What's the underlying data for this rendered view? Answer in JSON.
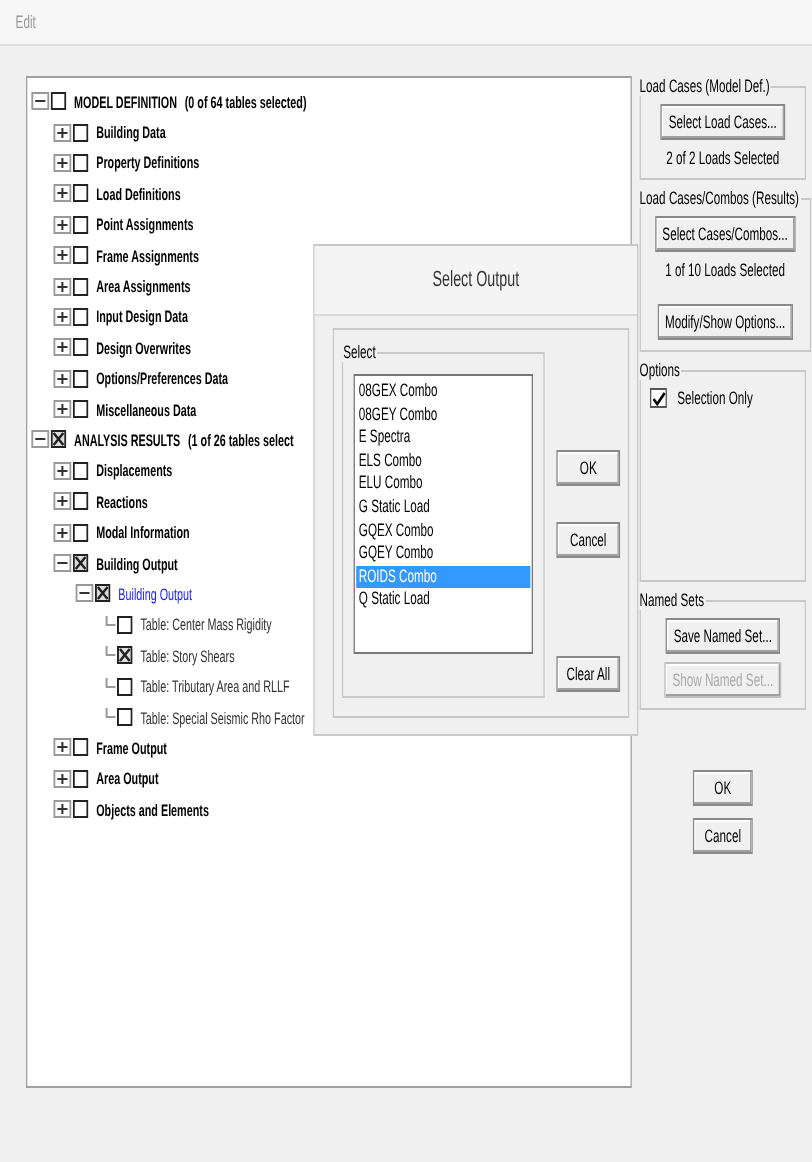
{
  "window": {
    "title": "Edit"
  },
  "tree": [
    {
      "label": "MODEL DEFINITION",
      "note": "(0 of 64 tables selected)",
      "checked": false,
      "expanded": true,
      "children": [
        {
          "label": "Building Data",
          "checked": false,
          "expanded": false,
          "selected": false
        },
        {
          "label": "Property Definitions",
          "checked": false,
          "expanded": false,
          "selected": false
        },
        {
          "label": "Load Definitions",
          "checked": false,
          "expanded": false,
          "selected": false
        },
        {
          "label": "Point Assignments",
          "checked": false,
          "expanded": false,
          "selected": false
        },
        {
          "label": "Frame Assignments",
          "checked": false,
          "expanded": false,
          "selected": false
        },
        {
          "label": "Area Assignments",
          "checked": false,
          "expanded": false,
          "selected": false
        },
        {
          "label": "Input Design Data",
          "checked": false,
          "expanded": false,
          "selected": false
        },
        {
          "label": "Design Overwrites",
          "checked": false,
          "expanded": false,
          "selected": false
        },
        {
          "label": "Options/Preferences Data",
          "checked": false,
          "expanded": false,
          "selected": false
        },
        {
          "label": "Miscellaneous Data",
          "checked": false,
          "expanded": false,
          "selected": false
        }
      ]
    },
    {
      "label": "ANALYSIS RESULTS",
      "note": "(1 of 26 tables select",
      "checked": true,
      "expanded": true,
      "children": [
        {
          "label": "Displacements",
          "checked": false,
          "expanded": false,
          "selected": false
        },
        {
          "label": "Reactions",
          "checked": false,
          "expanded": false,
          "selected": false
        },
        {
          "label": "Modal Information",
          "checked": false,
          "expanded": false,
          "selected": false
        },
        {
          "label": "Building Output",
          "checked": true,
          "expanded": true,
          "selected": false,
          "children": [
            {
              "label": "Building Output",
              "checked": true,
              "expanded": true,
              "selected": true,
              "children": [
                {
                  "label": "Table:  Center Mass Rigidity",
                  "checked": false,
                  "selected": false
                },
                {
                  "label": "Table:  Story Shears",
                  "checked": true,
                  "selected": false
                },
                {
                  "label": "Table:  Tributary Area and RLLF",
                  "checked": false,
                  "selected": false
                },
                {
                  "label": "Table:  Special Seismic Rho Factor",
                  "checked": false,
                  "selected": false
                }
              ]
            }
          ]
        },
        {
          "label": "Frame Output",
          "checked": false,
          "expanded": false,
          "selected": false
        },
        {
          "label": "Area Output",
          "checked": false,
          "expanded": false,
          "selected": false
        },
        {
          "label": "Objects and Elements",
          "checked": false,
          "expanded": false,
          "selected": false
        }
      ]
    }
  ],
  "load_cases_model": {
    "title": "Load Cases (Model Def.)",
    "button": "Select Load Cases...",
    "status": "2  of  2  Loads Selected"
  },
  "load_cases_results": {
    "title": "Load Cases/Combos (Results)",
    "button": "Select Cases/Combos...",
    "status": "1  of  10 Loads Selected",
    "options_button": "Modify/Show Options..."
  },
  "options": {
    "title": "Options",
    "selection_only": {
      "label": "Selection Only",
      "checked": true
    }
  },
  "named_sets": {
    "title": "Named Sets",
    "save_button": {
      "label": "Save Named Set...",
      "disabled": false
    },
    "show_button": {
      "label": "Show Named Set...",
      "disabled": true
    }
  },
  "buttons": [
    "OK",
    "Cancel"
  ],
  "dialog": {
    "title": "Select Output",
    "group": "Select",
    "items": [
      {
        "label": "08GEX Combo",
        "selected": false
      },
      {
        "label": "08GEY Combo",
        "selected": false
      },
      {
        "label": "E Spectra",
        "selected": false
      },
      {
        "label": "ELS Combo",
        "selected": false
      },
      {
        "label": "ELU Combo",
        "selected": false
      },
      {
        "label": "G Static Load",
        "selected": false
      },
      {
        "label": "GQEX Combo",
        "selected": false
      },
      {
        "label": "GQEY Combo",
        "selected": false
      },
      {
        "label": "ROIDS Combo",
        "selected": true
      },
      {
        "label": "Q Static Load",
        "selected": false
      }
    ],
    "ok": "OK",
    "cancel": "Cancel",
    "clear": "Clear All"
  }
}
